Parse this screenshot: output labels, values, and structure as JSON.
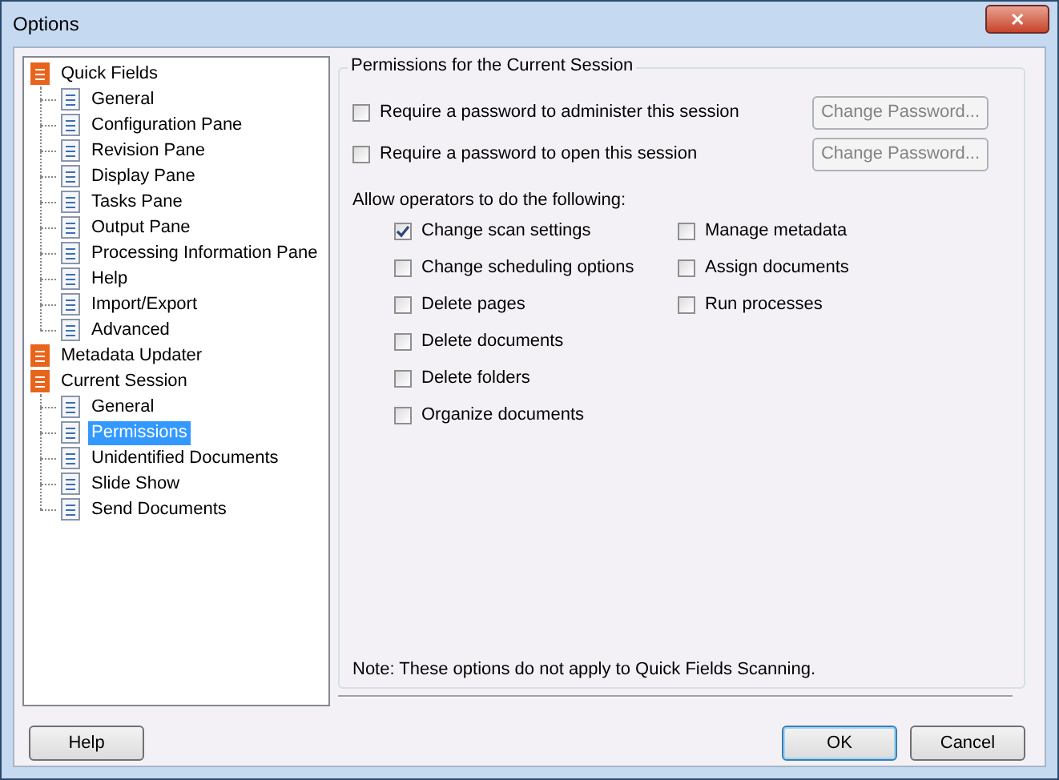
{
  "window": {
    "title": "Options",
    "close": "✕"
  },
  "tree": [
    {
      "label": "Quick Fields",
      "selected": false,
      "children": [
        {
          "label": "General",
          "selected": false
        },
        {
          "label": "Configuration Pane",
          "selected": false
        },
        {
          "label": "Revision Pane",
          "selected": false
        },
        {
          "label": "Display Pane",
          "selected": false
        },
        {
          "label": "Tasks Pane",
          "selected": false
        },
        {
          "label": "Output Pane",
          "selected": false
        },
        {
          "label": "Processing Information Pane",
          "selected": false
        },
        {
          "label": "Help",
          "selected": false
        },
        {
          "label": "Import/Export",
          "selected": false
        },
        {
          "label": "Advanced",
          "selected": false
        }
      ]
    },
    {
      "label": "Metadata Updater",
      "selected": false
    },
    {
      "label": "Current Session",
      "selected": false,
      "children": [
        {
          "label": "General",
          "selected": false
        },
        {
          "label": "Permissions",
          "selected": true
        },
        {
          "label": "Unidentified Documents",
          "selected": false
        },
        {
          "label": "Slide Show",
          "selected": false
        },
        {
          "label": "Send Documents",
          "selected": false
        }
      ]
    }
  ],
  "group": {
    "title": "Permissions for the Current Session",
    "passwords": [
      {
        "label": "Require a password to administer this session",
        "checked": false,
        "button": "Change Password...",
        "button_disabled": true
      },
      {
        "label": "Require a password to open this session",
        "checked": false,
        "button": "Change Password...",
        "button_disabled": true
      }
    ],
    "allow_label": "Allow operators to do the following:",
    "columns": [
      [
        {
          "label": "Change scan settings",
          "checked": true
        },
        {
          "label": "Change scheduling options",
          "checked": false
        },
        {
          "label": "Delete pages",
          "checked": false
        },
        {
          "label": "Delete documents",
          "checked": false
        },
        {
          "label": "Delete folders",
          "checked": false
        },
        {
          "label": "Organize documents",
          "checked": false
        }
      ],
      [
        {
          "label": "Manage metadata",
          "checked": false
        },
        {
          "label": "Assign documents",
          "checked": false
        },
        {
          "label": "Run processes",
          "checked": false
        }
      ]
    ],
    "note": "Note: These options do not apply to Quick Fields Scanning."
  },
  "buttons": {
    "help": "Help",
    "ok": "OK",
    "cancel": "Cancel"
  }
}
